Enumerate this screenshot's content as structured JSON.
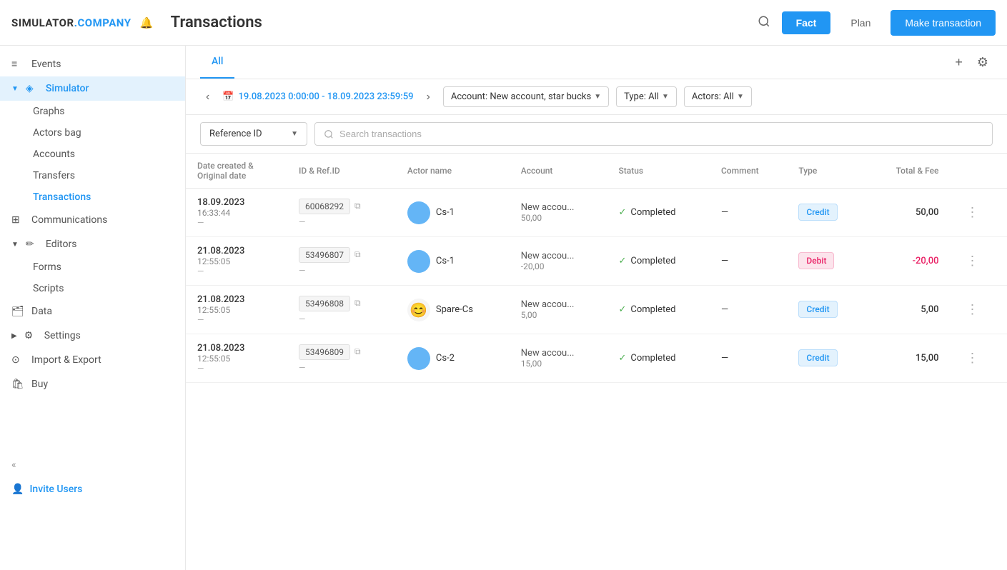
{
  "header": {
    "logo_simulator": "SIMULATOR",
    "logo_dot": ".",
    "logo_company": "COMPANY",
    "title": "Transactions",
    "fact_label": "Fact",
    "plan_label": "Plan",
    "make_transaction_label": "Make transaction"
  },
  "sidebar": {
    "items": [
      {
        "id": "events",
        "label": "Events",
        "icon": "≡"
      },
      {
        "id": "simulator",
        "label": "Simulator",
        "icon": "◈",
        "active": true,
        "expanded": true
      },
      {
        "id": "graphs",
        "label": "Graphs",
        "sub": true
      },
      {
        "id": "actors-bag",
        "label": "Actors bag",
        "sub": true
      },
      {
        "id": "accounts",
        "label": "Accounts",
        "sub": true
      },
      {
        "id": "transfers",
        "label": "Transfers",
        "sub": true
      },
      {
        "id": "transactions",
        "label": "Transactions",
        "sub": true,
        "active": true
      },
      {
        "id": "communications",
        "label": "Communications",
        "icon": "⊞"
      },
      {
        "id": "editors",
        "label": "Editors",
        "icon": "✏",
        "expanded": true
      },
      {
        "id": "forms",
        "label": "Forms",
        "sub": true
      },
      {
        "id": "scripts",
        "label": "Scripts",
        "sub": true
      },
      {
        "id": "data",
        "label": "Data",
        "icon": "🗂"
      },
      {
        "id": "settings",
        "label": "Settings",
        "icon": "⚙"
      },
      {
        "id": "import-export",
        "label": "Import & Export",
        "icon": "⊙"
      },
      {
        "id": "buy",
        "label": "Buy",
        "icon": "🛍"
      }
    ],
    "collapse_label": "«",
    "invite_users_label": "Invite Users"
  },
  "tabs": [
    {
      "id": "all",
      "label": "All",
      "active": true
    }
  ],
  "filters": {
    "date_range": "19.08.2023 0:00:00 - 18.09.2023 23:59:59",
    "account_filter": "Account: New account, star bucks",
    "type_filter": "Type: All",
    "actors_filter": "Actors: All"
  },
  "search": {
    "ref_id_label": "Reference ID",
    "placeholder": "Search transactions"
  },
  "table": {
    "columns": [
      "Date created & Original date",
      "ID & Ref.ID",
      "Actor name",
      "Account",
      "Status",
      "Comment",
      "Type",
      "Total & Fee"
    ],
    "rows": [
      {
        "date": "18.09.2023",
        "time": "16:33:44",
        "sub": "—",
        "id": "60068292",
        "ref_id": "—",
        "actor_name": "Cs-1",
        "actor_type": "circle",
        "account_name": "New accou...",
        "account_num": "50,00",
        "status": "Completed",
        "comment": "—",
        "type": "Credit",
        "total": "50,00",
        "negative": false
      },
      {
        "date": "21.08.2023",
        "time": "12:55:05",
        "sub": "—",
        "id": "53496807",
        "ref_id": "—",
        "actor_name": "Cs-1",
        "actor_type": "circle",
        "account_name": "New accou...",
        "account_num": "-20,00",
        "status": "Completed",
        "comment": "—",
        "type": "Debit",
        "total": "-20,00",
        "negative": true
      },
      {
        "date": "21.08.2023",
        "time": "12:55:05",
        "sub": "—",
        "id": "53496808",
        "ref_id": "—",
        "actor_name": "Spare-Cs",
        "actor_type": "emoji",
        "account_name": "New accou...",
        "account_num": "5,00",
        "status": "Completed",
        "comment": "—",
        "type": "Credit",
        "total": "5,00",
        "negative": false
      },
      {
        "date": "21.08.2023",
        "time": "12:55:05",
        "sub": "—",
        "id": "53496809",
        "ref_id": "—",
        "actor_name": "Cs-2",
        "actor_type": "circle",
        "account_name": "New accou...",
        "account_num": "15,00",
        "status": "Completed",
        "comment": "—",
        "type": "Credit",
        "total": "15,00",
        "negative": false
      }
    ]
  }
}
